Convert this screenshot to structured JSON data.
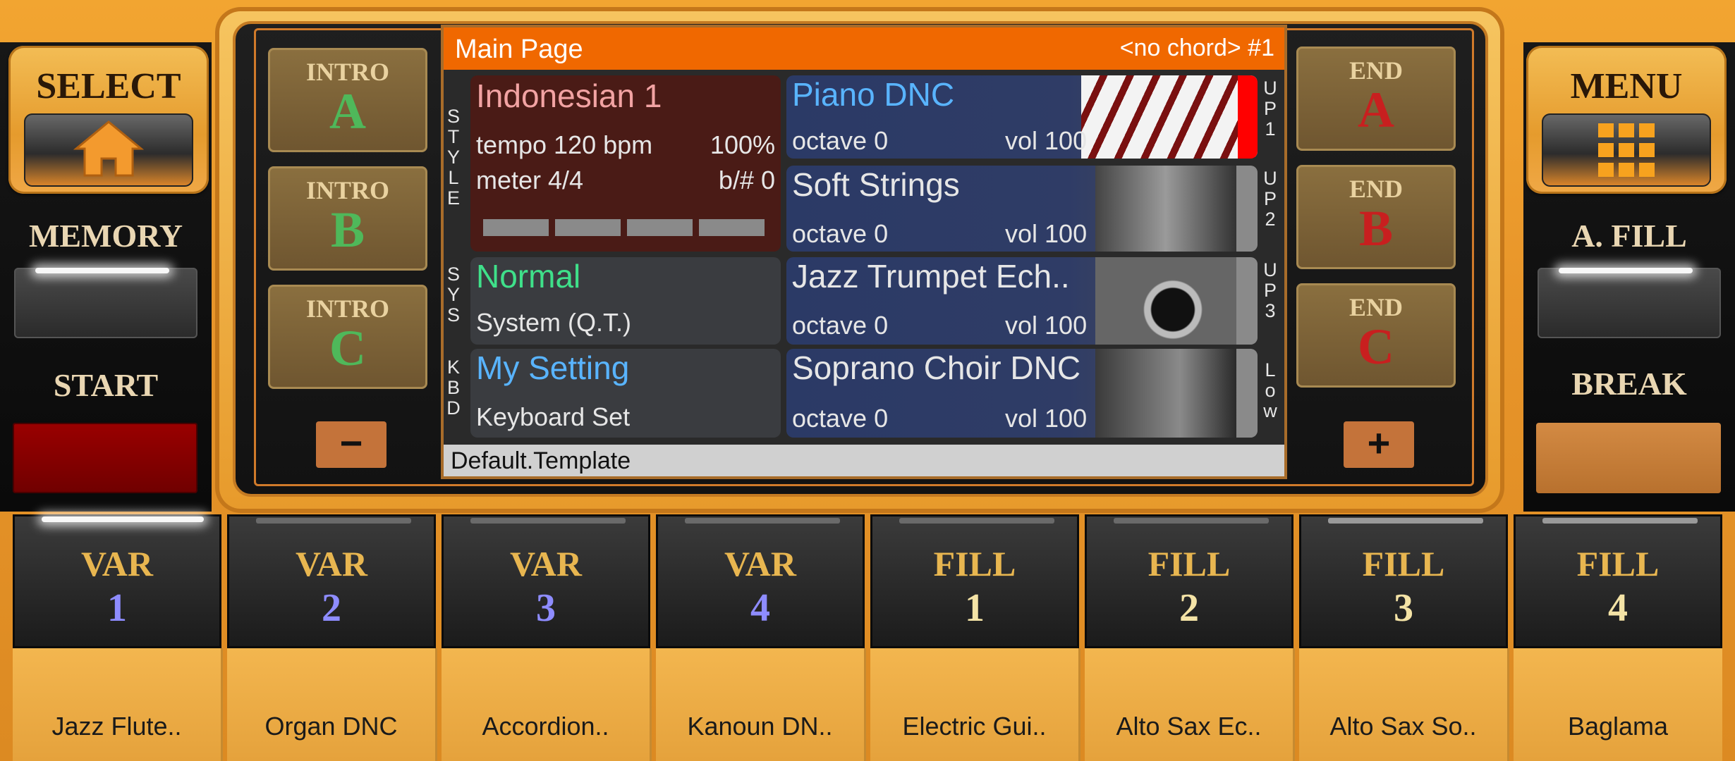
{
  "left_panel": {
    "select_label": "SELECT",
    "memory_label": "MEMORY",
    "start_label": "START"
  },
  "right_panel": {
    "menu_label": "MENU",
    "afill_label": "A. FILL",
    "break_label": "BREAK"
  },
  "intros": [
    {
      "title": "INTRO",
      "letter": "A"
    },
    {
      "title": "INTRO",
      "letter": "B"
    },
    {
      "title": "INTRO",
      "letter": "C"
    }
  ],
  "ends": [
    {
      "title": "END",
      "letter": "A"
    },
    {
      "title": "END",
      "letter": "B"
    },
    {
      "title": "END",
      "letter": "C"
    }
  ],
  "minus_label": "−",
  "plus_label": "+",
  "screen": {
    "title": "Main Page",
    "chord": "<no chord> #1",
    "side_left": [
      "STYLE",
      "SYS",
      "KBD"
    ],
    "side_right": [
      "UP1",
      "UP2",
      "UP3",
      "Low"
    ],
    "style": {
      "name": "Indonesian 1",
      "tempo": "tempo 120 bpm",
      "percent": "100%",
      "meter": "meter 4/4",
      "bsharp": "b/#  0"
    },
    "sys": {
      "name": "Normal",
      "sub": "System (Q.T.)"
    },
    "kbd": {
      "name": "My Setting",
      "sub": "Keyboard Set"
    },
    "voices": [
      {
        "name": "Piano DNC",
        "octave": "octave  0",
        "vol": "vol 100"
      },
      {
        "name": "Soft Strings",
        "octave": "octave  0",
        "vol": "vol 100"
      },
      {
        "name": "Jazz Trumpet Ech..",
        "octave": "octave  0",
        "vol": "vol 100"
      },
      {
        "name": "Soprano Choir DNC",
        "octave": "octave  0",
        "vol": "vol 100"
      }
    ],
    "footer": "Default.Template"
  },
  "variations": [
    {
      "title": "VAR",
      "num": "1"
    },
    {
      "title": "VAR",
      "num": "2"
    },
    {
      "title": "VAR",
      "num": "3"
    },
    {
      "title": "VAR",
      "num": "4"
    },
    {
      "title": "FILL",
      "num": "1"
    },
    {
      "title": "FILL",
      "num": "2"
    },
    {
      "title": "FILL",
      "num": "3"
    },
    {
      "title": "FILL",
      "num": "4"
    }
  ],
  "voice_tabs": [
    "Jazz Flute..",
    "Organ DNC",
    "Accordion..",
    "Kanoun DN..",
    "Electric Gui..",
    "Alto Sax Ec..",
    "Alto Sax So..",
    "Baglama"
  ],
  "colors": {
    "accent_orange": "#f06800",
    "intro_green": "#4fb85a",
    "end_red": "#c81f1f",
    "start_red": "#8a0000"
  }
}
